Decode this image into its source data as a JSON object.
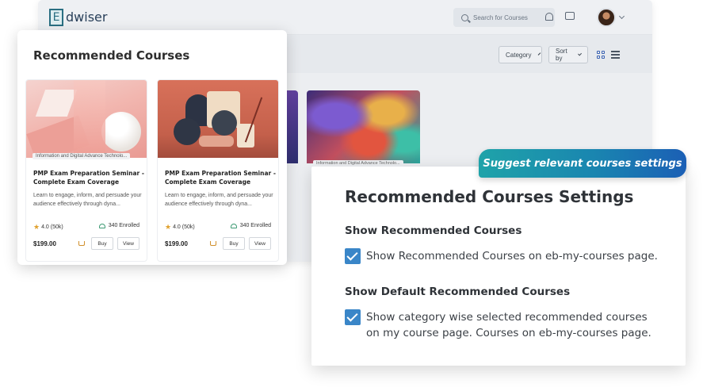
{
  "app": {
    "logo_letter": "E",
    "logo_text": "dwiser",
    "search_placeholder": "Search for Courses",
    "filters": {
      "category": "Category",
      "sort": "Sort by"
    }
  },
  "background_cards": [
    {
      "tag": "Information and Digital Advance Technolo..."
    }
  ],
  "recommended": {
    "title": "Recommended Courses",
    "courses": [
      {
        "tag": "Information and Digital Advance Technolo...",
        "name": "PMP Exam Preparation Seminar - Complete Exam Coverage",
        "description": "Learn to engage, inform, and persuade your audience effectively through dyna...",
        "rating": "4.0 (50k)",
        "enrolled": "340 Enrolled",
        "price": "$199.00",
        "buy_label": "Buy",
        "view_label": "View"
      },
      {
        "tag": "",
        "name": "PMP Exam Preparation Seminar - Complete Exam Coverage",
        "description": "Learn to engage, inform, and persuade your audience effectively through dyna...",
        "rating": "4.0 (50k)",
        "enrolled": "340 Enrolled",
        "price": "$199.00",
        "buy_label": "Buy",
        "view_label": "View"
      }
    ]
  },
  "badge": "Suggest relevant courses settings",
  "settings": {
    "title": "Recommended Courses Settings",
    "show_recommended": {
      "heading": "Show Recommended Courses",
      "checked": true,
      "label": "Show Recommended Courses on eb-my-courses page."
    },
    "show_default": {
      "heading": "Show Default Recommended Courses",
      "checked": true,
      "label_line1": "Show category wise selected recommended courses",
      "label_line2": "on my course page. Courses on eb-my-courses page."
    }
  },
  "colors": {
    "accent_blue": "#3a86c8",
    "badge_gradient_start": "#1fa3a9",
    "badge_gradient_end": "#1b5fb5",
    "star": "#e0a12e"
  }
}
